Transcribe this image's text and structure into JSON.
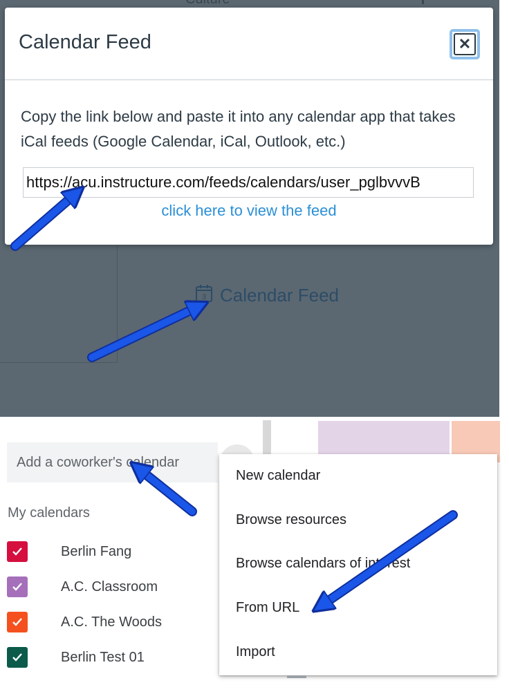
{
  "top": {
    "background_text": "Culture",
    "modal": {
      "title": "Calendar Feed",
      "close_symbol": "✕",
      "description": "Copy the link below and paste it into any calendar app that takes iCal feeds (Google Calendar, iCal, Outlook, etc.)",
      "feed_url": "https://acu.instructure.com/feeds/calendars/user_pglbvvvB",
      "view_link": "click here to view the feed"
    },
    "calendar_feed_button": {
      "label": "Calendar Feed",
      "icon": "calendar-icon",
      "icon_day": "3"
    }
  },
  "bottom": {
    "coworker_search": {
      "placeholder": "Add a coworker's calendar"
    },
    "my_calendars_label": "My calendars",
    "calendars": [
      {
        "name": "Berlin Fang",
        "color": "#d50f3e",
        "checked": true
      },
      {
        "name": "A.C. Classroom",
        "color": "#a66fba",
        "checked": true
      },
      {
        "name": "A.C. The Woods",
        "color": "#f4511e",
        "checked": true
      },
      {
        "name": "Berlin Test 01",
        "color": "#0b5a4a",
        "checked": true
      }
    ],
    "add_menu": {
      "items": [
        "New calendar",
        "Browse resources",
        "Browse calendars of interest",
        "From URL",
        "Import"
      ]
    }
  },
  "colors": {
    "overlay": "#5b6872",
    "canvas_text": "#2d3b45",
    "link_blue": "#2b8fd6",
    "arrow_blue": "#1a56e8"
  }
}
